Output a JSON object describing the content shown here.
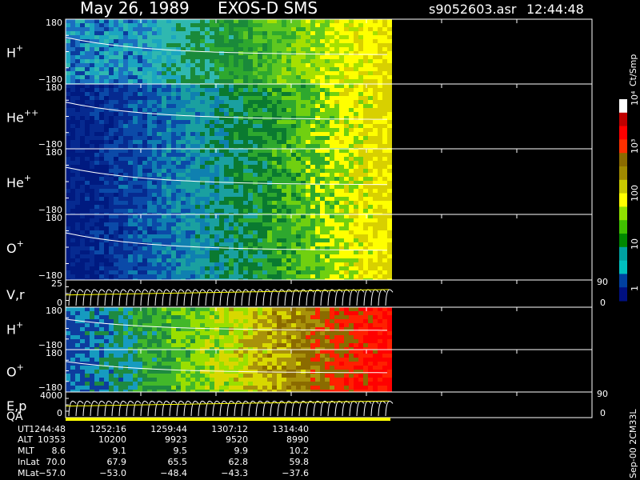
{
  "header": {
    "date": "May 26, 1989",
    "instrument": "EXOS-D SMS",
    "file": "s9052603.asr",
    "time": "12:44:48"
  },
  "panels": [
    {
      "id": "h-plus",
      "label": "H",
      "sup": "+",
      "ymax": "180",
      "ymin": "−180",
      "right_top": "",
      "right_bottom": "",
      "kind": "spectrogram",
      "palette": "low"
    },
    {
      "id": "he-plus-plus",
      "label": "He",
      "sup": "++",
      "ymax": "180",
      "ymin": "−180",
      "right_top": "",
      "right_bottom": "",
      "kind": "spectrogram",
      "palette": "dark"
    },
    {
      "id": "he-plus",
      "label": "He",
      "sup": "+",
      "ymax": "180",
      "ymin": "−180",
      "right_top": "",
      "right_bottom": "",
      "kind": "spectrogram",
      "palette": "dark"
    },
    {
      "id": "o-plus",
      "label": "O",
      "sup": "+",
      "ymax": "180",
      "ymin": "−180",
      "right_top": "",
      "right_bottom": "",
      "kind": "spectrogram",
      "palette": "dark"
    },
    {
      "id": "v-r",
      "label": "V,r",
      "sup": "",
      "ymax": "25",
      "ymin": "0",
      "right_top": "90",
      "right_bottom": "0",
      "kind": "trace",
      "palette": ""
    },
    {
      "id": "h-plus-2",
      "label": "H",
      "sup": "+",
      "ymax": "180",
      "ymin": "−180",
      "right_top": "",
      "right_bottom": "",
      "kind": "spectrogram",
      "palette": "hot"
    },
    {
      "id": "o-plus-2",
      "label": "O",
      "sup": "+",
      "ymax": "180",
      "ymin": "−180",
      "right_top": "",
      "right_bottom": "",
      "kind": "spectrogram",
      "palette": "hot"
    },
    {
      "id": "e-p",
      "label": "E,p",
      "sup": "",
      "ymax": "4000",
      "ymin": "0",
      "right_top": "90",
      "right_bottom": "0",
      "kind": "trace",
      "palette": ""
    }
  ],
  "qa_label": "QA",
  "colorbar": {
    "unit": "Ct/Smp",
    "labels": [
      "10⁴",
      "10³",
      "100",
      "10",
      "1"
    ],
    "colors": [
      "#ffffff",
      "#c00000",
      "#ff0000",
      "#ff3000",
      "#8b6b00",
      "#a08a00",
      "#c8c800",
      "#ffff00",
      "#90e000",
      "#40c000",
      "#008800",
      "#00a0a0",
      "#00c0c0",
      "#0040a0",
      "#001080"
    ]
  },
  "ephemeris": {
    "row_labels": [
      "UT",
      "ALT",
      "MLT",
      "InLat",
      "MLat"
    ],
    "columns": [
      [
        "1244:48",
        "10353",
        "8.6",
        "70.0",
        "−57.0"
      ],
      [
        "1252:16",
        "10200",
        "9.1",
        "67.9",
        "−53.0"
      ],
      [
        "1259:44",
        "9923",
        "9.5",
        "65.5",
        "−48.4"
      ],
      [
        "1307:12",
        "9520",
        "9.9",
        "62.8",
        "−43.3"
      ],
      [
        "1314:40",
        "8990",
        "10.2",
        "59.8",
        "−37.6"
      ]
    ]
  },
  "footer_note": "Sep-00 2CM33L",
  "chart_data": {
    "type": "heatmap",
    "title": "May 26, 1989   EXOS-D SMS",
    "x": [
      "1244:48",
      "1252:16",
      "1259:44",
      "1307:12",
      "1314:40"
    ],
    "panels": [
      {
        "name": "H+",
        "ylim": [
          -180,
          180
        ],
        "levels": [
          15,
          15,
          40,
          40,
          100,
          100
        ]
      },
      {
        "name": "He++",
        "ylim": [
          -180,
          180
        ],
        "levels": [
          1,
          2,
          15,
          40,
          100,
          100
        ]
      },
      {
        "name": "He+",
        "ylim": [
          -180,
          180
        ],
        "levels": [
          1,
          3,
          20,
          40,
          100,
          100
        ]
      },
      {
        "name": "O+",
        "ylim": [
          -180,
          180
        ],
        "levels": [
          1,
          2,
          15,
          40,
          100,
          100
        ]
      },
      {
        "name": "H+",
        "ylim": [
          -180,
          180
        ],
        "levels": [
          15,
          40,
          100,
          300,
          1000,
          1000
        ]
      },
      {
        "name": "O+",
        "ylim": [
          -180,
          180
        ],
        "levels": [
          10,
          40,
          100,
          400,
          1000,
          1000
        ]
      }
    ],
    "colorbar_range": [
      1,
      10000
    ],
    "colorbar_scale": "log",
    "colorbar_label": "Ct/Smp"
  }
}
